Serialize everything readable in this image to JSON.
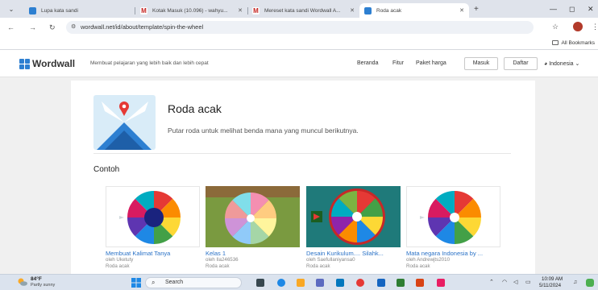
{
  "browser": {
    "tabs": [
      {
        "title": "Lupa kata sandi",
        "favicon_color": "#2d7fd1",
        "active": false
      },
      {
        "title": "Kotak Masuk (10.096) - wahyu...",
        "favicon_color": "#c5221f",
        "active": false
      },
      {
        "title": "Mereset kata sandi Wordwall A...",
        "favicon_color": "#c5221f",
        "active": false
      },
      {
        "title": "Roda acak",
        "favicon_color": "#2d7fd1",
        "active": true
      }
    ],
    "new_tab": "+",
    "url": "wordwall.net/id/about/template/spin-the-wheel",
    "bookmarks_label": "All Bookmarks"
  },
  "site": {
    "logo": "Wordwall",
    "tagline": "Membuat pelajaran yang lebih baik dan lebih cepat",
    "nav": [
      "Beranda",
      "Fitur",
      "Paket harga"
    ],
    "login": "Masuk",
    "signup": "Daftar",
    "language": "Indonesia"
  },
  "template": {
    "title": "Roda acak",
    "description": "Putar roda untuk melihat benda mana yang muncul berikutnya.",
    "examples_heading": "Contoh",
    "examples": [
      {
        "title": "Membuat Kalimat Tanya",
        "author": "oleh Uketuty",
        "type": "Roda acak"
      },
      {
        "title": "Kelas 1",
        "author": "oleh Ila246536",
        "type": "Roda acak"
      },
      {
        "title": "Desain Kurikulum.... Silahk...",
        "author": "oleh Saefullaniyansa0",
        "type": "Roda acak"
      },
      {
        "title": "Mata negara Indonesia by ...",
        "author": "oleh Andrewjts2010",
        "type": "Roda acak"
      }
    ]
  },
  "taskbar": {
    "weather_temp": "84°F",
    "weather_desc": "Partly sunny",
    "search_label": "Search",
    "time": "10:09 AM",
    "date": "5/11/2024"
  },
  "colors": {
    "brand_blue": "#2a72c7",
    "wheel_segments": [
      "#e53935",
      "#fb8c00",
      "#fdd835",
      "#43a047",
      "#1e88e5",
      "#5e35b1",
      "#d81b60",
      "#00acc1"
    ]
  }
}
